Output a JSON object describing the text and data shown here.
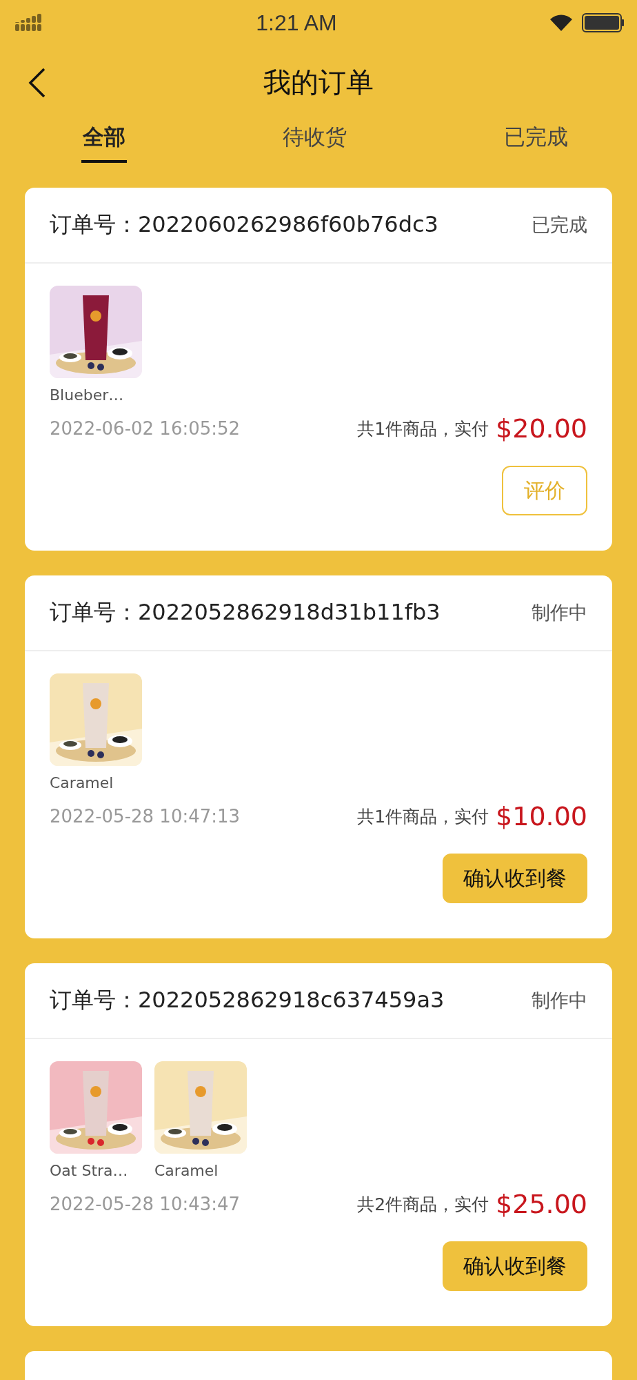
{
  "status_bar": {
    "time": "1:21 AM"
  },
  "header": {
    "title": "我的订单"
  },
  "tabs": [
    {
      "label": "全部",
      "selected": true
    },
    {
      "label": "待收货",
      "selected": false
    },
    {
      "label": "已完成",
      "selected": false
    }
  ],
  "orders": [
    {
      "label": "订单号：",
      "number": "2022060262986f60b76dc3",
      "status": "已完成",
      "items": [
        {
          "name": "Blueber…",
          "kind": "picture"
        }
      ],
      "time": "2022-06-02 16:05:52",
      "summary": "共1件商品，实付",
      "price": "$20.00",
      "action": {
        "kind": "outline",
        "label": "评价"
      }
    },
    {
      "label": "订单号：",
      "number": "2022052862918d31b11fb3",
      "status": "制作中",
      "items": [
        {
          "name": "Caramel",
          "kind": "picture"
        }
      ],
      "time": "2022-05-28 10:47:13",
      "summary": "共1件商品，实付",
      "price": "$10.00",
      "action": {
        "kind": "filled",
        "label": "确认收到餐"
      }
    },
    {
      "label": "订单号：",
      "number": "2022052862918c637459a3",
      "status": "制作中",
      "items": [
        {
          "name": "Oat Stra…",
          "kind": "picture"
        },
        {
          "name": "Caramel",
          "kind": "picture"
        }
      ],
      "time": "2022-05-28 10:43:47",
      "summary": "共2件商品，实付",
      "price": "$25.00",
      "action": {
        "kind": "filled",
        "label": "确认收到餐"
      }
    }
  ]
}
